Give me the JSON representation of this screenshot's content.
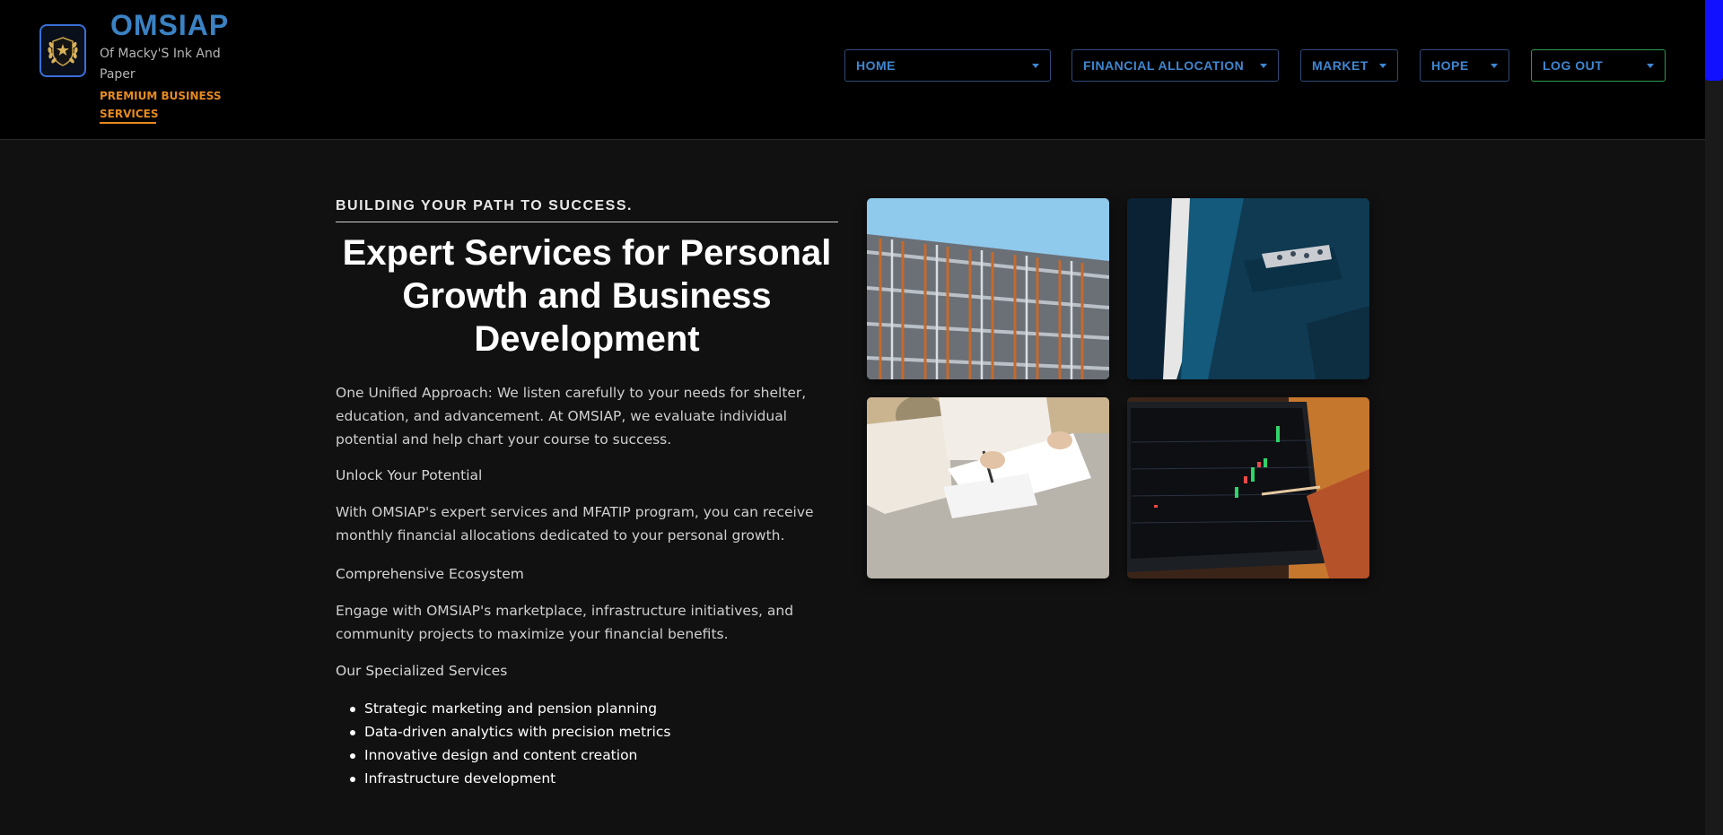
{
  "header": {
    "brand_name": "OMSIAP",
    "brand_subtitle": "Of Macky'S Ink And Paper",
    "brand_tagline": "PREMIUM BUSINESS SERVICES",
    "logo_icon": "laurel-shield-icon"
  },
  "nav": {
    "items": [
      {
        "label": "HOME"
      },
      {
        "label": "FINANCIAL ALLOCATION"
      },
      {
        "label": "MARKET"
      },
      {
        "label": "HOPE"
      },
      {
        "label": "LOG OUT"
      }
    ]
  },
  "main": {
    "eyebrow": "BUILDING YOUR PATH TO SUCCESS.",
    "headline": "Expert Services for Personal Growth and Business Development",
    "intro": "One Unified Approach: We listen carefully to your needs for shelter, education, and advancement. At OMSIAP, we evaluate individual potential and help chart your course to success.",
    "potential_heading": "Unlock Your Potential",
    "potential_text": "With OMSIAP's expert services and MFATIP program, you can receive monthly financial allocations dedicated to your personal growth.",
    "ecosystem_heading": "Comprehensive Ecosystem",
    "ecosystem_text": "Engage with OMSIAP's marketplace, infrastructure initiatives, and community projects to maximize your financial benefits.",
    "services_heading": "Our Specialized Services",
    "services": [
      "Strategic marketing and pension planning",
      "Data-driven analytics with precision metrics",
      "Innovative design and content creation",
      "Infrastructure development"
    ]
  },
  "colors": {
    "accent_blue": "#3b82c4",
    "accent_orange": "#e58a1f",
    "logout_border": "#2f9a4a",
    "scroll_thumb": "#1111ff"
  }
}
